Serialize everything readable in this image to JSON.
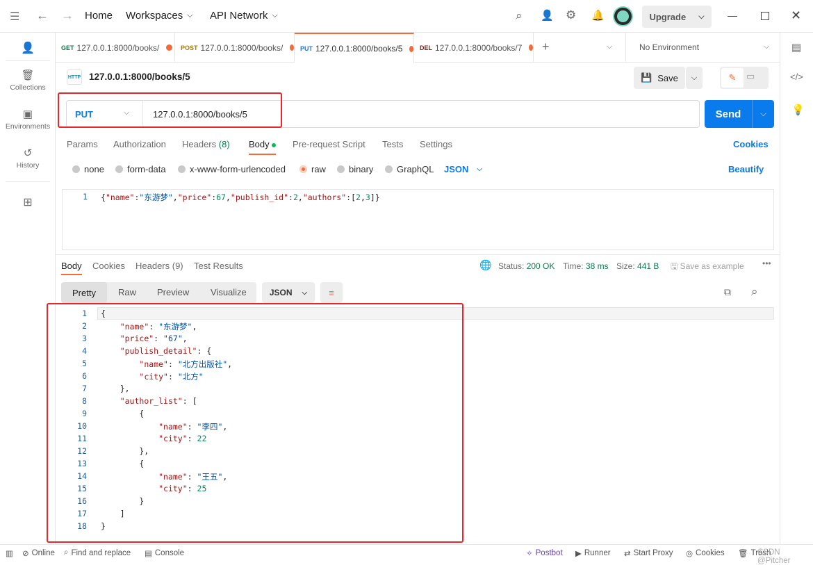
{
  "titlebar": {
    "home": "Home",
    "workspaces": "Workspaces",
    "api_network": "API Network",
    "upgrade": "Upgrade"
  },
  "sidebar": {
    "items": [
      {
        "label": ""
      },
      {
        "label": "Collections"
      },
      {
        "label": "Environments"
      },
      {
        "label": "History"
      }
    ]
  },
  "tabs": [
    {
      "method": "GET",
      "url": "127.0.0.1:8000/books/",
      "color": "#0b7a4b"
    },
    {
      "method": "POST",
      "url": "127.0.0.1:8000/books/",
      "color": "#ad7a03"
    },
    {
      "method": "PUT",
      "url": "127.0.0.1:8000/books/5",
      "color": "#097bed"
    },
    {
      "method": "DEL",
      "url": "127.0.0.1:8000/books/7",
      "color": "#8e1a10"
    }
  ],
  "environment": "No Environment",
  "request": {
    "name": "127.0.0.1:8000/books/5",
    "method": "PUT",
    "url": "127.0.0.1:8000/books/5",
    "save": "Save",
    "send": "Send"
  },
  "request_tabs": {
    "params": "Params",
    "authorization": "Authorization",
    "headers": "Headers",
    "headers_count": "(8)",
    "body": "Body",
    "prerequest": "Pre-request Script",
    "tests": "Tests",
    "settings": "Settings",
    "cookies": "Cookies"
  },
  "body_types": {
    "none": "none",
    "form_data": "form-data",
    "urlencoded": "x-www-form-urlencoded",
    "raw": "raw",
    "binary": "binary",
    "graphql": "GraphQL",
    "format": "JSON",
    "beautify": "Beautify",
    "selected": "raw"
  },
  "request_body": {
    "line_number": "1",
    "code": "{\"name\":\"东游梦\",\"price\":67,\"publish_id\":2,\"authors\":[2,3]}"
  },
  "response": {
    "tabs": {
      "body": "Body",
      "cookies": "Cookies",
      "headers": "Headers (9)",
      "test_results": "Test Results"
    },
    "status_label": "Status:",
    "status": "200 OK",
    "time_label": "Time:",
    "time": "38 ms",
    "size_label": "Size:",
    "size": "441 B",
    "save_example": "Save as example",
    "views": {
      "pretty": "Pretty",
      "raw": "Raw",
      "preview": "Preview",
      "visualize": "Visualize",
      "format": "JSON"
    },
    "lines": [
      "{",
      "    \"name\": \"东游梦\",",
      "    \"price\": \"67\",",
      "    \"publish_detail\": {",
      "        \"name\": \"北方出版社\",",
      "        \"city\": \"北方\"",
      "    },",
      "    \"author_list\": [",
      "        {",
      "            \"name\": \"李四\",",
      "            \"city\": 22",
      "        },",
      "        {",
      "            \"name\": \"王五\",",
      "            \"city\": 25",
      "        }",
      "    ]",
      "}"
    ]
  },
  "statusbar": {
    "online": "Online",
    "find_replace": "Find and replace",
    "console": "Console",
    "postbot": "Postbot",
    "runner": "Runner",
    "start_proxy": "Start Proxy",
    "cookies": "Cookies",
    "trash": "Trash",
    "watermark": "CSDN @Pitcher"
  },
  "colors": {
    "accent": "#f26b3a",
    "send": "#097bed",
    "annotation": "#e8262b",
    "status_ok": "#0b7a4b"
  }
}
